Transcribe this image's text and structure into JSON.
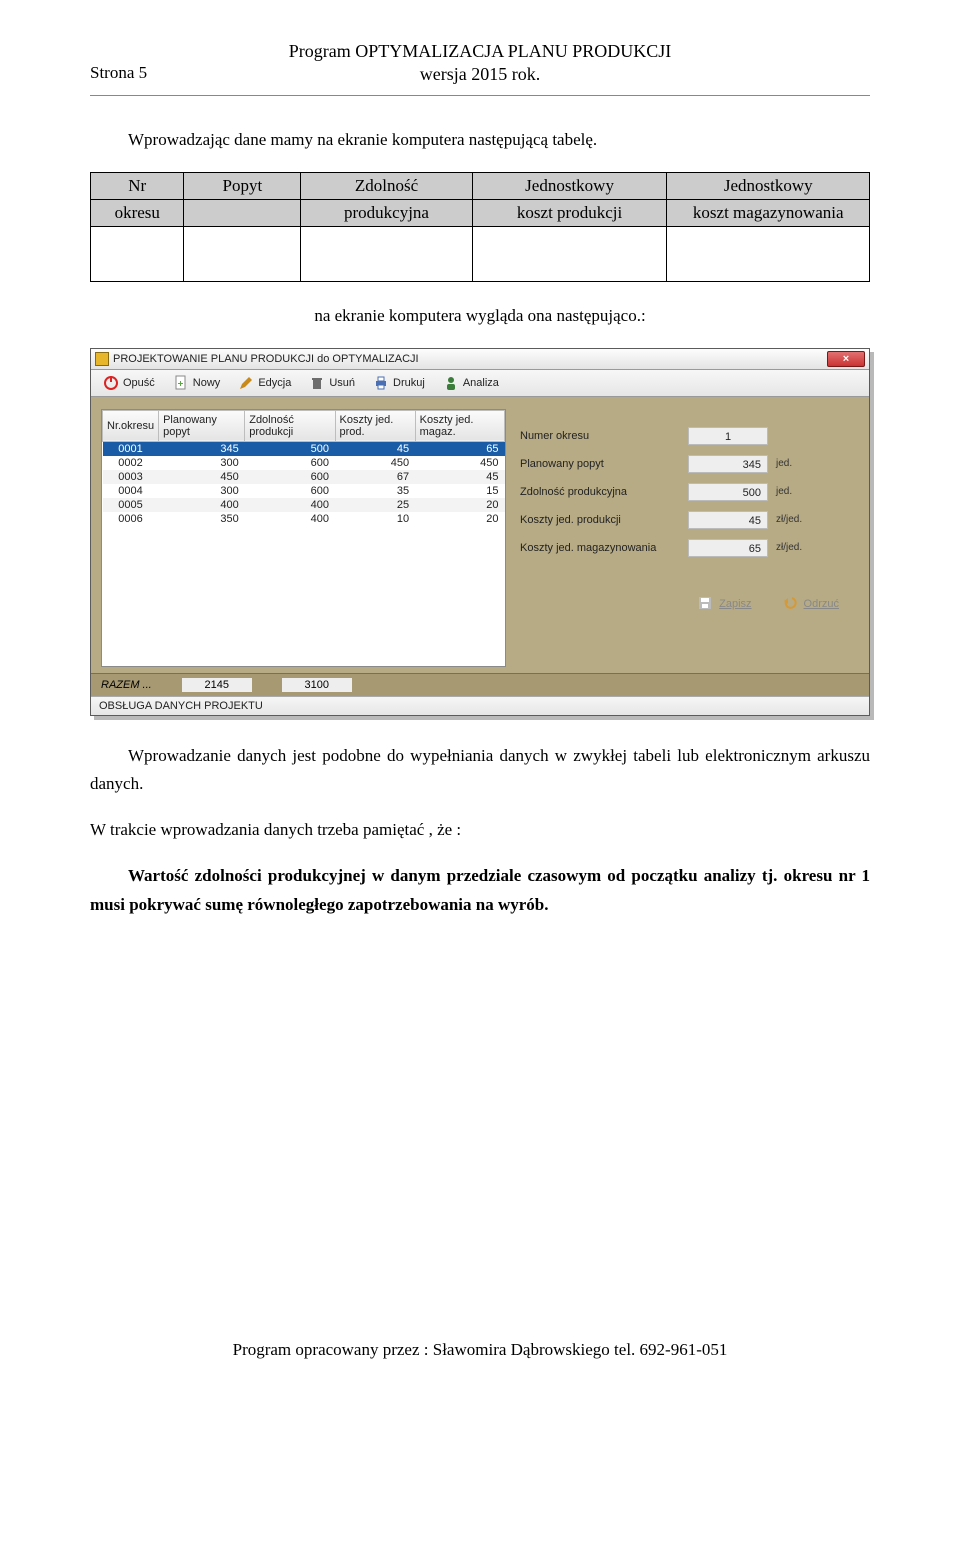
{
  "header": {
    "title_line1": "Program OPTYMALIZACJA  PLANU  PRODUKCJI",
    "title_line2": "wersja 2015 rok.",
    "page_label": "Strona 5"
  },
  "text": {
    "intro": "Wprowadzając dane mamy na ekranie komputera następującą tabelę.",
    "after_table": "na ekranie komputera wygląda ona następująco.:",
    "para2": "Wprowadzanie danych jest podobne do wypełniania danych w zwykłej tabeli lub elektronicznym arkuszu danych.",
    "para3": "W trakcie wprowadzania danych trzeba pamiętać , że :",
    "bold1": "Wartość  zdolności produkcyjnej w danym przedziale czasowym od początku analizy tj. okresu nr 1 musi pokrywać sumę równoległego zapotrzebowania na wyrób."
  },
  "defs_table": {
    "c0a": "Nr",
    "c0b": "okresu",
    "c1": "Popyt",
    "c2a": "Zdolność",
    "c2b": "produkcyjna",
    "c3a": "Jednostkowy",
    "c3b": "koszt produkcji",
    "c4a": "Jednostkowy",
    "c4b": "koszt magazynowania"
  },
  "app": {
    "title": "PROJEKTOWANIE PLANU PRODUKCJI do OPTYMALIZACJI",
    "close_glyph": "×",
    "toolbar": {
      "opusc": "Opuść",
      "nowy": "Nowy",
      "edycja": "Edycja",
      "usun": "Usuń",
      "drukuj": "Drukuj",
      "analiza": "Analiza"
    },
    "grid_headers": {
      "nr": "Nr.okresu",
      "popyt": "Planowany popyt",
      "zdol": "Zdolność produkcji",
      "kprod": "Koszty jed. prod.",
      "kmag": "Koszty jed. magaz."
    },
    "rows": [
      {
        "nr": "0001",
        "popyt": "345",
        "zdol": "500",
        "kp": "45",
        "km": "65"
      },
      {
        "nr": "0002",
        "popyt": "300",
        "zdol": "600",
        "kp": "450",
        "km": "450"
      },
      {
        "nr": "0003",
        "popyt": "450",
        "zdol": "600",
        "kp": "67",
        "km": "45"
      },
      {
        "nr": "0004",
        "popyt": "300",
        "zdol": "600",
        "kp": "35",
        "km": "15"
      },
      {
        "nr": "0005",
        "popyt": "400",
        "zdol": "400",
        "kp": "25",
        "km": "20"
      },
      {
        "nr": "0006",
        "popyt": "350",
        "zdol": "400",
        "kp": "10",
        "km": "20"
      }
    ],
    "form": {
      "numer_label": "Numer okresu",
      "numer_val": "1",
      "popyt_label": "Planowany popyt",
      "popyt_val": "345",
      "popyt_unit": "jed.",
      "zdol_label": "Zdolność produkcyjna",
      "zdol_val": "500",
      "zdol_unit": "jed.",
      "kprod_label": "Koszty jed. produkcji",
      "kprod_val": "45",
      "kprod_unit": "zł/jed.",
      "kmag_label": "Koszty jed. magazynowania",
      "kmag_val": "65",
      "kmag_unit": "zł/jed.",
      "zapisz": "Zapisz",
      "odrzuc": "Odrzuć"
    },
    "razem": {
      "label": "RAZEM ...",
      "sum_popyt": "2145",
      "sum_zdol": "3100"
    },
    "status": "OBSŁUGA  DANYCH PROJEKTU"
  },
  "footer": "Program opracowany przez : Sławomira Dąbrowskiego  tel.  692-961-051"
}
